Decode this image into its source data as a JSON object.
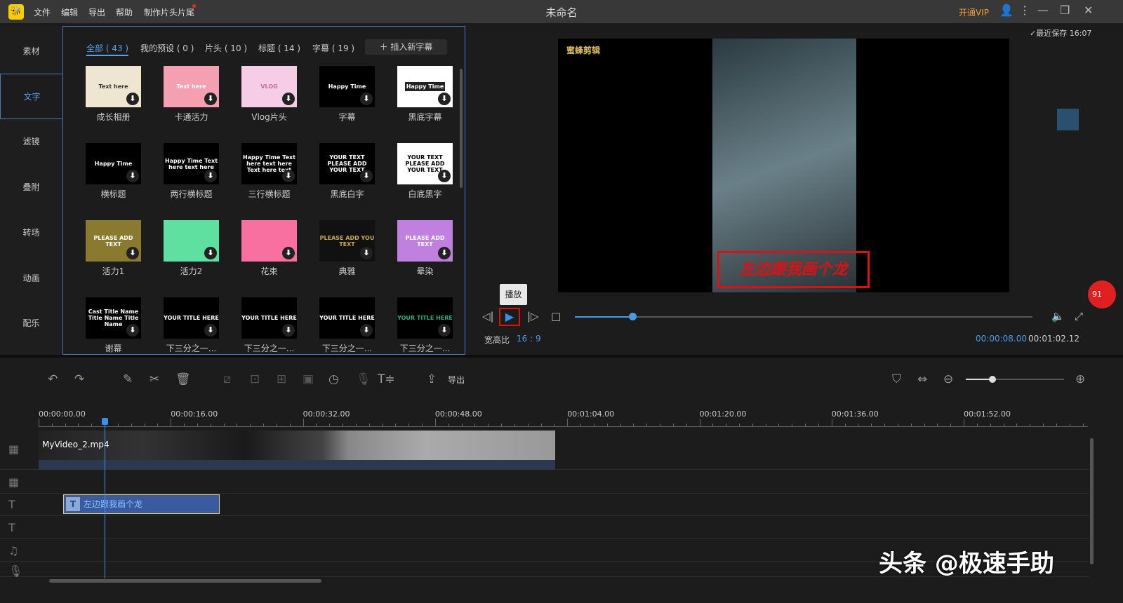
{
  "app": {
    "title": "未命名",
    "menu": [
      "文件",
      "编辑",
      "导出",
      "帮助",
      "制作片头片尾"
    ],
    "vip": "开通VIP",
    "logo_icon": "bee-logo"
  },
  "sidebar": {
    "items": [
      {
        "label": "素材"
      },
      {
        "label": "文字",
        "active": true
      },
      {
        "label": "滤镜"
      },
      {
        "label": "叠附"
      },
      {
        "label": "转场"
      },
      {
        "label": "动画"
      },
      {
        "label": "配乐"
      }
    ]
  },
  "filters": {
    "tabs": [
      "全部 ( 43 )",
      "我的预设 ( 0 )",
      "片头 ( 10 )",
      "标题 ( 14 )",
      "字幕 ( 19 )"
    ],
    "insert": "插入新字幕"
  },
  "templates": [
    {
      "label": "成长相册",
      "thumb": "Text here",
      "bg": "#efe6d2",
      "fg": "#333"
    },
    {
      "label": "卡通活力",
      "thumb": "Text here",
      "bg": "#f4a0b0",
      "fg": "#fff"
    },
    {
      "label": "Vlog片头",
      "thumb": "VLOG",
      "bg": "#f6cde6",
      "fg": "#c070a0"
    },
    {
      "label": "字幕",
      "thumb": "Happy Time",
      "bg": "#000",
      "fg": "#fff"
    },
    {
      "label": "黑底字幕",
      "thumb": "Happy Time",
      "bg": "#fff",
      "fg": "#fff"
    },
    {
      "label": "横标题",
      "thumb": "Happy Time",
      "bg": "#000",
      "fg": "#fff"
    },
    {
      "label": "两行横标题",
      "thumb": "Happy Time Text here text here",
      "bg": "#000",
      "fg": "#fff"
    },
    {
      "label": "三行横标题",
      "thumb": "Happy Time Text here text here Text here text",
      "bg": "#000",
      "fg": "#fff"
    },
    {
      "label": "黑底白字",
      "thumb": "YOUR TEXT PLEASE ADD YOUR TEXT",
      "bg": "#000",
      "fg": "#fff"
    },
    {
      "label": "白底黑字",
      "thumb": "YOUR TEXT PLEASE ADD YOUR TEXT",
      "bg": "#fff",
      "fg": "#000"
    },
    {
      "label": "活力1",
      "thumb": "PLEASE ADD TEXT",
      "bg": "#8a7a30",
      "fg": "#fff"
    },
    {
      "label": "活力2",
      "thumb": "",
      "bg": "#60e0a0",
      "fg": "#fff"
    },
    {
      "label": "花束",
      "thumb": "",
      "bg": "#f870a0",
      "fg": "#fff"
    },
    {
      "label": "典雅",
      "thumb": "PLEASE ADD YOU TEXT",
      "bg": "#111",
      "fg": "#c8a850"
    },
    {
      "label": "晕染",
      "thumb": "PLEASE ADD TEXT",
      "bg": "#c080e0",
      "fg": "#fff"
    },
    {
      "label": "谢幕",
      "thumb": "Cast Title Name Title Name Title Name",
      "bg": "#000",
      "fg": "#fff"
    },
    {
      "label": "下三分之一...",
      "thumb": "YOUR TITLE HERE",
      "bg": "#000",
      "fg": "#fff"
    },
    {
      "label": "下三分之一...",
      "thumb": "YOUR TITLE HERE",
      "bg": "#000",
      "fg": "#fff"
    },
    {
      "label": "下三分之一...",
      "thumb": "YOUR TITLE HERE",
      "bg": "#000",
      "fg": "#fff"
    },
    {
      "label": "下三分之一...",
      "thumb": "YOUR TITLE HERE",
      "bg": "#000",
      "fg": "#20b080"
    }
  ],
  "preview": {
    "saved": "最近保存 16:07",
    "video_logo": "蜜蜂剪辑",
    "caption": "左边跟我画个龙",
    "tooltip": "播放",
    "aspect_label": "宽高比",
    "aspect": "16 : 9",
    "current_time": "00:00:08.00",
    "total_time": "00:01:02.12",
    "progress_percent": 12.8,
    "badge": "91"
  },
  "toolbar": {
    "export": "导出",
    "zoom_percent": 27
  },
  "timeline": {
    "ruler": [
      "00:00:00.00",
      "00:00:16.00",
      "00:00:32.00",
      "00:00:48.00",
      "00:01:04.00",
      "00:01:20.00",
      "00:01:36.00",
      "00:01:52.00"
    ],
    "video_clip": "MyVideo_2.mp4",
    "text_clip": "左边跟我画个龙"
  },
  "watermark": "头条 @极速手助",
  "colors": {
    "accent": "#4a9ae8",
    "highlight": "#e01010",
    "vip": "#f0a030"
  }
}
